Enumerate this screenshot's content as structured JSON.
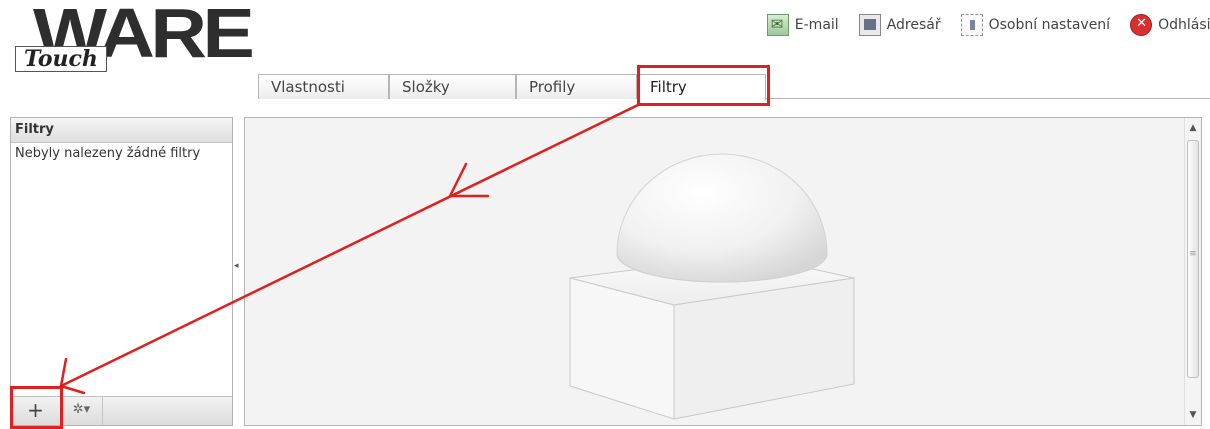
{
  "logo": {
    "brand": "WARE",
    "prefix": "Touch"
  },
  "toplinks": [
    {
      "label": "E-mail",
      "icon": "email-icon"
    },
    {
      "label": "Adresář",
      "icon": "address-book-icon"
    },
    {
      "label": "Osobní nastavení",
      "icon": "personal-settings-icon"
    },
    {
      "label": "Odhlásit",
      "icon": "logout-icon"
    }
  ],
  "tabs": [
    {
      "label": "Vlastnosti"
    },
    {
      "label": "Složky"
    },
    {
      "label": "Profily"
    },
    {
      "label": "Filtry",
      "active": true
    }
  ],
  "leftpanel": {
    "title": "Filtry",
    "empty_text": "Nebyly nalezeny žádné filtry",
    "add_label": "+",
    "gear_label": "✲▾"
  },
  "annotation_color": "#e01f1f"
}
